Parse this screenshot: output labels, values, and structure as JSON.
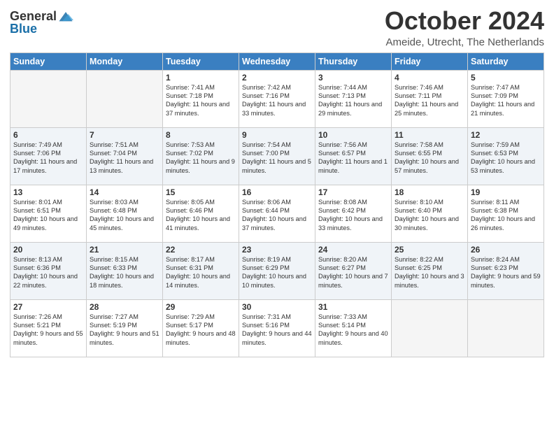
{
  "header": {
    "logo_line1": "General",
    "logo_line2": "Blue",
    "month": "October 2024",
    "location": "Ameide, Utrecht, The Netherlands"
  },
  "days_of_week": [
    "Sunday",
    "Monday",
    "Tuesday",
    "Wednesday",
    "Thursday",
    "Friday",
    "Saturday"
  ],
  "weeks": [
    [
      {
        "day": "",
        "sunrise": "",
        "sunset": "",
        "daylight": "",
        "empty": true
      },
      {
        "day": "",
        "sunrise": "",
        "sunset": "",
        "daylight": "",
        "empty": true
      },
      {
        "day": "1",
        "sunrise": "Sunrise: 7:41 AM",
        "sunset": "Sunset: 7:18 PM",
        "daylight": "Daylight: 11 hours and 37 minutes."
      },
      {
        "day": "2",
        "sunrise": "Sunrise: 7:42 AM",
        "sunset": "Sunset: 7:16 PM",
        "daylight": "Daylight: 11 hours and 33 minutes."
      },
      {
        "day": "3",
        "sunrise": "Sunrise: 7:44 AM",
        "sunset": "Sunset: 7:13 PM",
        "daylight": "Daylight: 11 hours and 29 minutes."
      },
      {
        "day": "4",
        "sunrise": "Sunrise: 7:46 AM",
        "sunset": "Sunset: 7:11 PM",
        "daylight": "Daylight: 11 hours and 25 minutes."
      },
      {
        "day": "5",
        "sunrise": "Sunrise: 7:47 AM",
        "sunset": "Sunset: 7:09 PM",
        "daylight": "Daylight: 11 hours and 21 minutes."
      }
    ],
    [
      {
        "day": "6",
        "sunrise": "Sunrise: 7:49 AM",
        "sunset": "Sunset: 7:06 PM",
        "daylight": "Daylight: 11 hours and 17 minutes."
      },
      {
        "day": "7",
        "sunrise": "Sunrise: 7:51 AM",
        "sunset": "Sunset: 7:04 PM",
        "daylight": "Daylight: 11 hours and 13 minutes."
      },
      {
        "day": "8",
        "sunrise": "Sunrise: 7:53 AM",
        "sunset": "Sunset: 7:02 PM",
        "daylight": "Daylight: 11 hours and 9 minutes."
      },
      {
        "day": "9",
        "sunrise": "Sunrise: 7:54 AM",
        "sunset": "Sunset: 7:00 PM",
        "daylight": "Daylight: 11 hours and 5 minutes."
      },
      {
        "day": "10",
        "sunrise": "Sunrise: 7:56 AM",
        "sunset": "Sunset: 6:57 PM",
        "daylight": "Daylight: 11 hours and 1 minute."
      },
      {
        "day": "11",
        "sunrise": "Sunrise: 7:58 AM",
        "sunset": "Sunset: 6:55 PM",
        "daylight": "Daylight: 10 hours and 57 minutes."
      },
      {
        "day": "12",
        "sunrise": "Sunrise: 7:59 AM",
        "sunset": "Sunset: 6:53 PM",
        "daylight": "Daylight: 10 hours and 53 minutes."
      }
    ],
    [
      {
        "day": "13",
        "sunrise": "Sunrise: 8:01 AM",
        "sunset": "Sunset: 6:51 PM",
        "daylight": "Daylight: 10 hours and 49 minutes."
      },
      {
        "day": "14",
        "sunrise": "Sunrise: 8:03 AM",
        "sunset": "Sunset: 6:48 PM",
        "daylight": "Daylight: 10 hours and 45 minutes."
      },
      {
        "day": "15",
        "sunrise": "Sunrise: 8:05 AM",
        "sunset": "Sunset: 6:46 PM",
        "daylight": "Daylight: 10 hours and 41 minutes."
      },
      {
        "day": "16",
        "sunrise": "Sunrise: 8:06 AM",
        "sunset": "Sunset: 6:44 PM",
        "daylight": "Daylight: 10 hours and 37 minutes."
      },
      {
        "day": "17",
        "sunrise": "Sunrise: 8:08 AM",
        "sunset": "Sunset: 6:42 PM",
        "daylight": "Daylight: 10 hours and 33 minutes."
      },
      {
        "day": "18",
        "sunrise": "Sunrise: 8:10 AM",
        "sunset": "Sunset: 6:40 PM",
        "daylight": "Daylight: 10 hours and 30 minutes."
      },
      {
        "day": "19",
        "sunrise": "Sunrise: 8:11 AM",
        "sunset": "Sunset: 6:38 PM",
        "daylight": "Daylight: 10 hours and 26 minutes."
      }
    ],
    [
      {
        "day": "20",
        "sunrise": "Sunrise: 8:13 AM",
        "sunset": "Sunset: 6:36 PM",
        "daylight": "Daylight: 10 hours and 22 minutes."
      },
      {
        "day": "21",
        "sunrise": "Sunrise: 8:15 AM",
        "sunset": "Sunset: 6:33 PM",
        "daylight": "Daylight: 10 hours and 18 minutes."
      },
      {
        "day": "22",
        "sunrise": "Sunrise: 8:17 AM",
        "sunset": "Sunset: 6:31 PM",
        "daylight": "Daylight: 10 hours and 14 minutes."
      },
      {
        "day": "23",
        "sunrise": "Sunrise: 8:19 AM",
        "sunset": "Sunset: 6:29 PM",
        "daylight": "Daylight: 10 hours and 10 minutes."
      },
      {
        "day": "24",
        "sunrise": "Sunrise: 8:20 AM",
        "sunset": "Sunset: 6:27 PM",
        "daylight": "Daylight: 10 hours and 7 minutes."
      },
      {
        "day": "25",
        "sunrise": "Sunrise: 8:22 AM",
        "sunset": "Sunset: 6:25 PM",
        "daylight": "Daylight: 10 hours and 3 minutes."
      },
      {
        "day": "26",
        "sunrise": "Sunrise: 8:24 AM",
        "sunset": "Sunset: 6:23 PM",
        "daylight": "Daylight: 9 hours and 59 minutes."
      }
    ],
    [
      {
        "day": "27",
        "sunrise": "Sunrise: 7:26 AM",
        "sunset": "Sunset: 5:21 PM",
        "daylight": "Daylight: 9 hours and 55 minutes."
      },
      {
        "day": "28",
        "sunrise": "Sunrise: 7:27 AM",
        "sunset": "Sunset: 5:19 PM",
        "daylight": "Daylight: 9 hours and 51 minutes."
      },
      {
        "day": "29",
        "sunrise": "Sunrise: 7:29 AM",
        "sunset": "Sunset: 5:17 PM",
        "daylight": "Daylight: 9 hours and 48 minutes."
      },
      {
        "day": "30",
        "sunrise": "Sunrise: 7:31 AM",
        "sunset": "Sunset: 5:16 PM",
        "daylight": "Daylight: 9 hours and 44 minutes."
      },
      {
        "day": "31",
        "sunrise": "Sunrise: 7:33 AM",
        "sunset": "Sunset: 5:14 PM",
        "daylight": "Daylight: 9 hours and 40 minutes."
      },
      {
        "day": "",
        "sunrise": "",
        "sunset": "",
        "daylight": "",
        "empty": true
      },
      {
        "day": "",
        "sunrise": "",
        "sunset": "",
        "daylight": "",
        "empty": true
      }
    ]
  ]
}
